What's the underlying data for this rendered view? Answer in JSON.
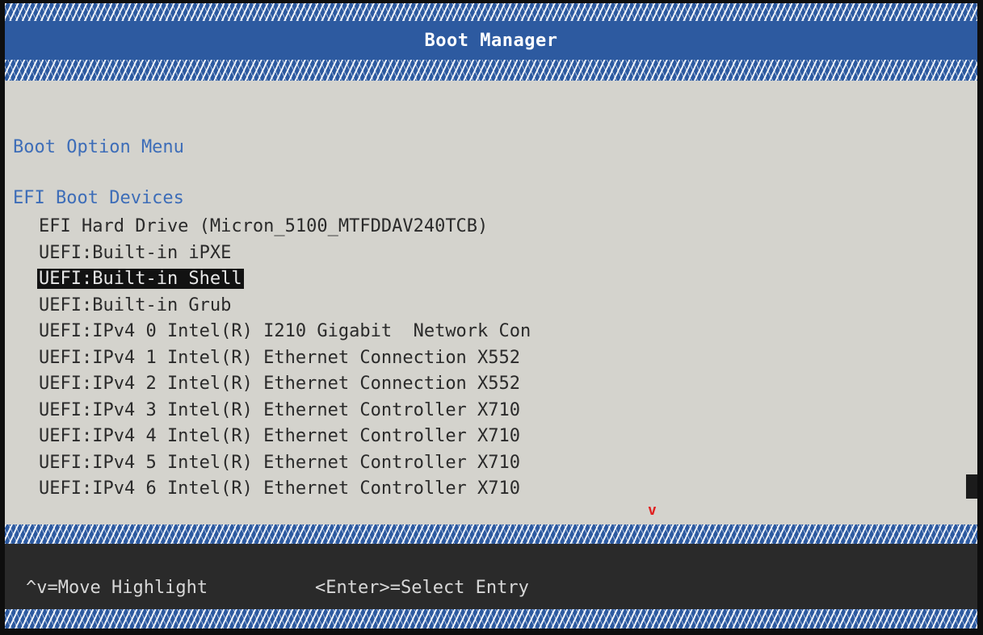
{
  "window": {
    "title": "Boot Manager"
  },
  "sections": {
    "menu_title": "Boot Option Menu",
    "devices_title": "EFI Boot Devices"
  },
  "boot_devices": [
    {
      "label": "EFI Hard Drive (Micron_5100_MTFDDAV240TCB)",
      "selected": false
    },
    {
      "label": "UEFI:Built-in iPXE",
      "selected": false
    },
    {
      "label": "UEFI:Built-in Shell",
      "selected": true
    },
    {
      "label": "UEFI:Built-in Grub",
      "selected": false
    },
    {
      "label": "UEFI:IPv4 0 Intel(R) I210 Gigabit  Network Con",
      "selected": false
    },
    {
      "label": "UEFI:IPv4 1 Intel(R) Ethernet Connection X552",
      "selected": false
    },
    {
      "label": "UEFI:IPv4 2 Intel(R) Ethernet Connection X552",
      "selected": false
    },
    {
      "label": "UEFI:IPv4 3 Intel(R) Ethernet Controller X710",
      "selected": false
    },
    {
      "label": "UEFI:IPv4 4 Intel(R) Ethernet Controller X710",
      "selected": false
    },
    {
      "label": "UEFI:IPv4 5 Intel(R) Ethernet Controller X710",
      "selected": false
    },
    {
      "label": "UEFI:IPv4 6 Intel(R) Ethernet Controller X710",
      "selected": false
    }
  ],
  "scroll": {
    "more_below_indicator": "v"
  },
  "help": {
    "move": "^v=Move Highlight",
    "select": "<Enter>=Select Entry"
  },
  "colors": {
    "border_blue": "#2d5aa0",
    "content_bg": "#d4d3cd",
    "section_text": "#3d6db8",
    "item_text": "#2a2a2a",
    "highlight_bg": "#121212",
    "footer_bg": "#2a2a2a",
    "more_arrow": "#e02020"
  }
}
